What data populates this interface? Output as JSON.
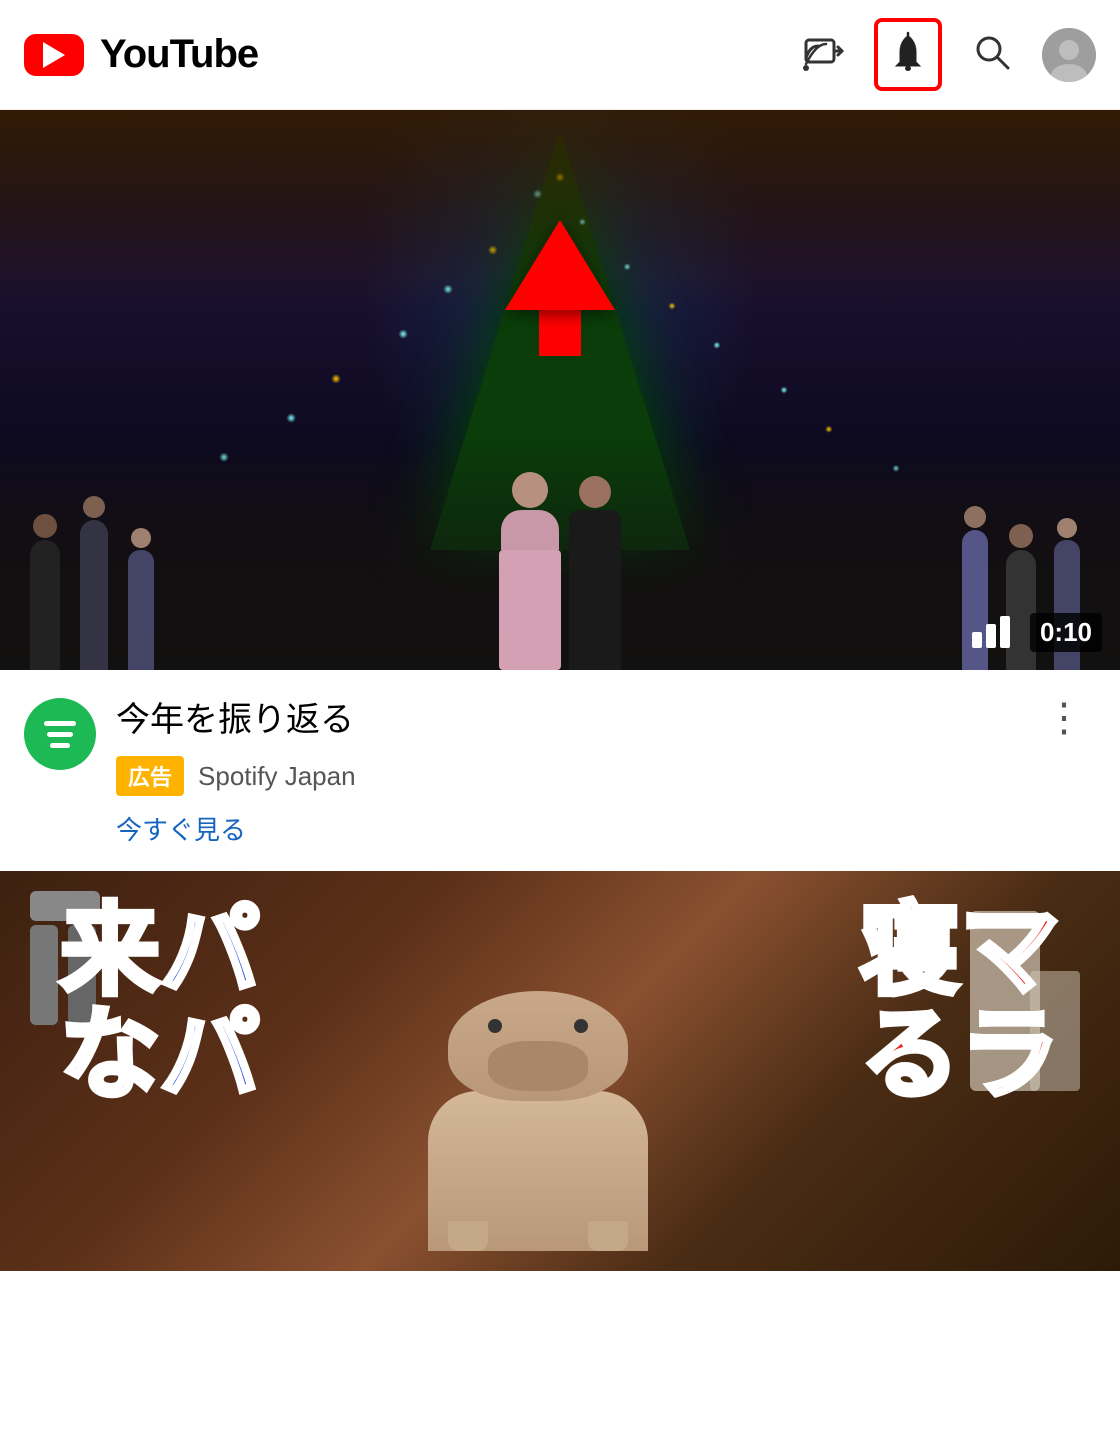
{
  "header": {
    "title": "YouTube",
    "icons": {
      "cast": "cast-icon",
      "bell": "bell-icon",
      "search": "search-icon",
      "avatar": "avatar-icon"
    }
  },
  "video1": {
    "duration": "0:10",
    "title": "今年を振り返る",
    "ad_badge": "広告",
    "channel_name": "Spotify Japan",
    "cta_text": "今すぐ見る",
    "more_options_label": "⋮"
  },
  "video2": {
    "text_left_line1": "来パ",
    "text_left_line2": "なパ",
    "text_right_line1": "寝マ",
    "text_right_line2": "るラ"
  },
  "annotation": {
    "bell_highlighted": true,
    "arrow_direction": "up",
    "arrow_color": "#FF0000"
  }
}
